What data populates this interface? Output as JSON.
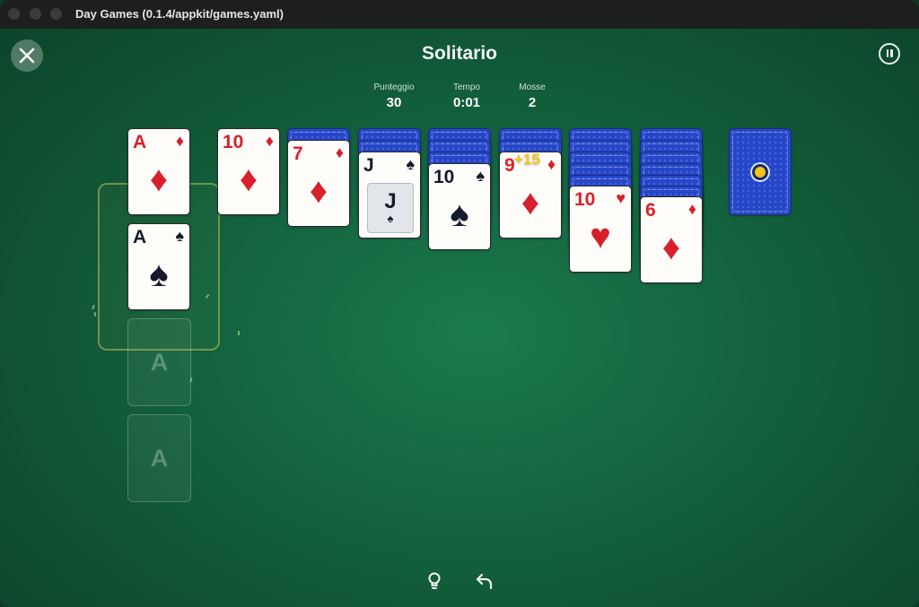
{
  "window": {
    "title": "Day Games (0.1.4/appkit/games.yaml)"
  },
  "game": {
    "title": "Solitario"
  },
  "stats": {
    "score": {
      "label": "Punteggio",
      "value": "30"
    },
    "time": {
      "label": "Tempo",
      "value": "0:01"
    },
    "moves": {
      "label": "Mosse",
      "value": "2"
    }
  },
  "foundations": [
    {
      "rank": "A",
      "suit": "♦",
      "color": "red"
    },
    {
      "rank": "A",
      "suit": "♠",
      "color": "black"
    },
    {
      "label": "A"
    },
    {
      "label": "A"
    }
  ],
  "tableau": [
    {
      "hidden": 0,
      "rank": "10",
      "suit": "♦",
      "color": "red"
    },
    {
      "hidden": 1,
      "rank": "7",
      "suit": "♦",
      "color": "red"
    },
    {
      "hidden": 2,
      "rank": "J",
      "suit": "♠",
      "color": "black",
      "face": true
    },
    {
      "hidden": 3,
      "rank": "10",
      "suit": "♠",
      "color": "black"
    },
    {
      "hidden": 2,
      "rank": "9",
      "suit": "♦",
      "color": "red"
    },
    {
      "hidden": 5,
      "rank": "10",
      "suit": "♥",
      "color": "red"
    },
    {
      "hidden": 6,
      "rank": "6",
      "suit": "♦",
      "color": "red"
    }
  ],
  "score_popup": "+15",
  "colors": {
    "felt": "#1b7a4d",
    "card_back": "#2546c8",
    "red_suit": "#d8202c",
    "black_suit": "#161a2c",
    "popup": "#f5c518"
  },
  "icons": {
    "close": "close-icon",
    "pause": "pause-icon",
    "hint": "lightbulb-icon",
    "undo": "undo-icon"
  }
}
